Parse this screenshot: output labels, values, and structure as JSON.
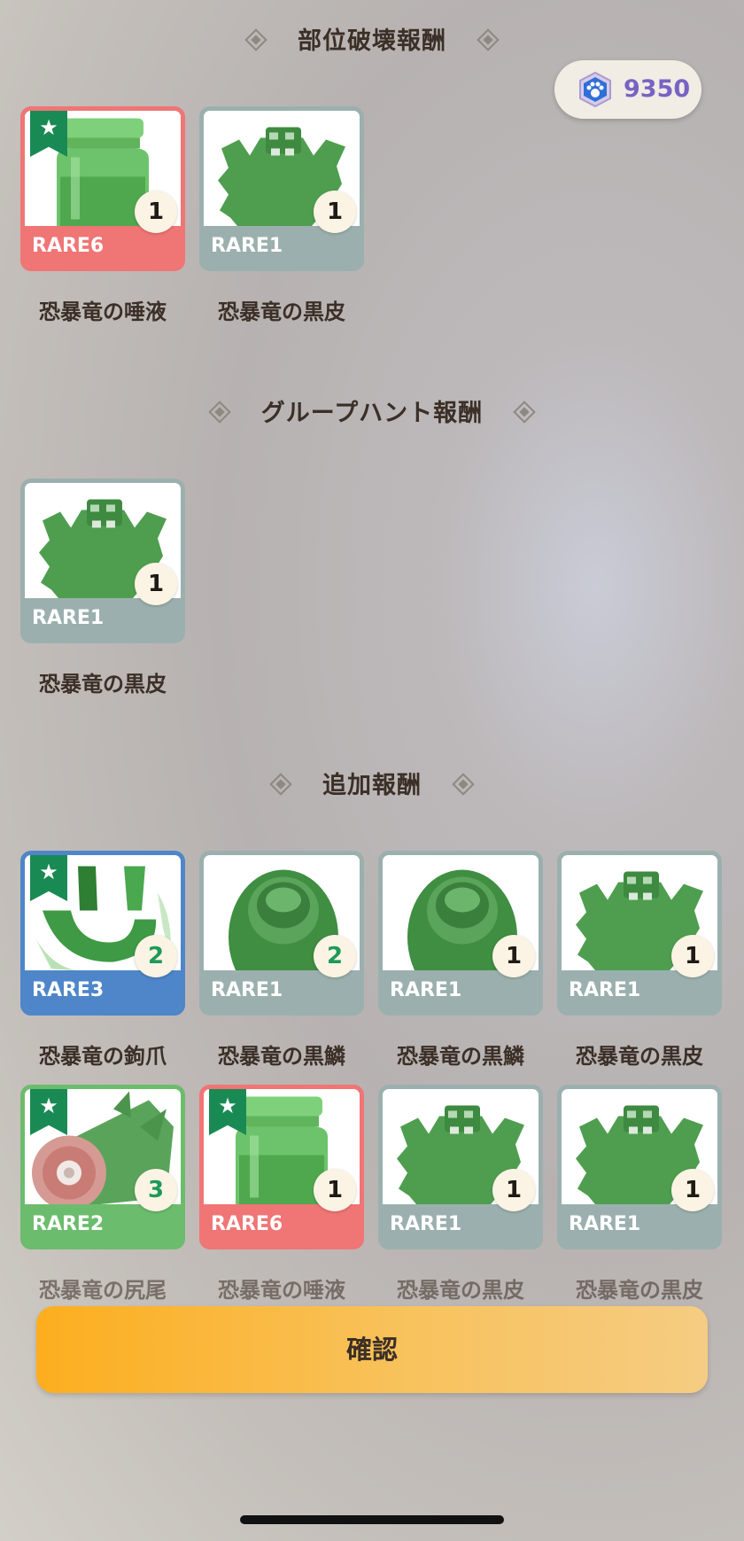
{
  "currency": {
    "icon": "paw-gem-icon",
    "value": "9350"
  },
  "sections": [
    {
      "title": "部位破壊報酬"
    },
    {
      "title": "グループハント報酬"
    },
    {
      "title": "追加報酬"
    }
  ],
  "items": [
    {
      "rarity": "RARE6",
      "count": "1",
      "name": "恐暴竜の唾液",
      "icon": "jar-icon",
      "starred": true
    },
    {
      "rarity": "RARE1",
      "count": "1",
      "name": "恐暴竜の黒皮",
      "icon": "hide-icon",
      "starred": false
    },
    {
      "rarity": "RARE1",
      "count": "1",
      "name": "恐暴竜の黒皮",
      "icon": "hide-icon",
      "starred": false
    },
    {
      "rarity": "RARE3",
      "count": "2",
      "name": "恐暴竜の鉤爪",
      "icon": "claw-icon",
      "starred": true
    },
    {
      "rarity": "RARE1",
      "count": "2",
      "name": "恐暴竜の黒鱗",
      "icon": "scale-icon",
      "starred": false
    },
    {
      "rarity": "RARE1",
      "count": "1",
      "name": "恐暴竜の黒鱗",
      "icon": "scale-icon",
      "starred": false
    },
    {
      "rarity": "RARE1",
      "count": "1",
      "name": "恐暴竜の黒皮",
      "icon": "hide-icon",
      "starred": false
    },
    {
      "rarity": "RARE2",
      "count": "3",
      "name": "恐暴竜の尻尾",
      "icon": "tail-icon",
      "starred": true
    },
    {
      "rarity": "RARE6",
      "count": "1",
      "name": "恐暴竜の唾液",
      "icon": "jar-icon",
      "starred": true
    },
    {
      "rarity": "RARE1",
      "count": "1",
      "name": "恐暴竜の黒皮",
      "icon": "hide-icon",
      "starred": false
    },
    {
      "rarity": "RARE1",
      "count": "1",
      "name": "恐暴竜の黒皮",
      "icon": "hide-icon",
      "starred": false
    }
  ],
  "confirm_label": "確認",
  "colors": {
    "rare1": "#9bb0ae",
    "rare2": "#6cbc6d",
    "rare3": "#4e86c9",
    "rare6": "#f07575",
    "star": "#1a8a55"
  }
}
